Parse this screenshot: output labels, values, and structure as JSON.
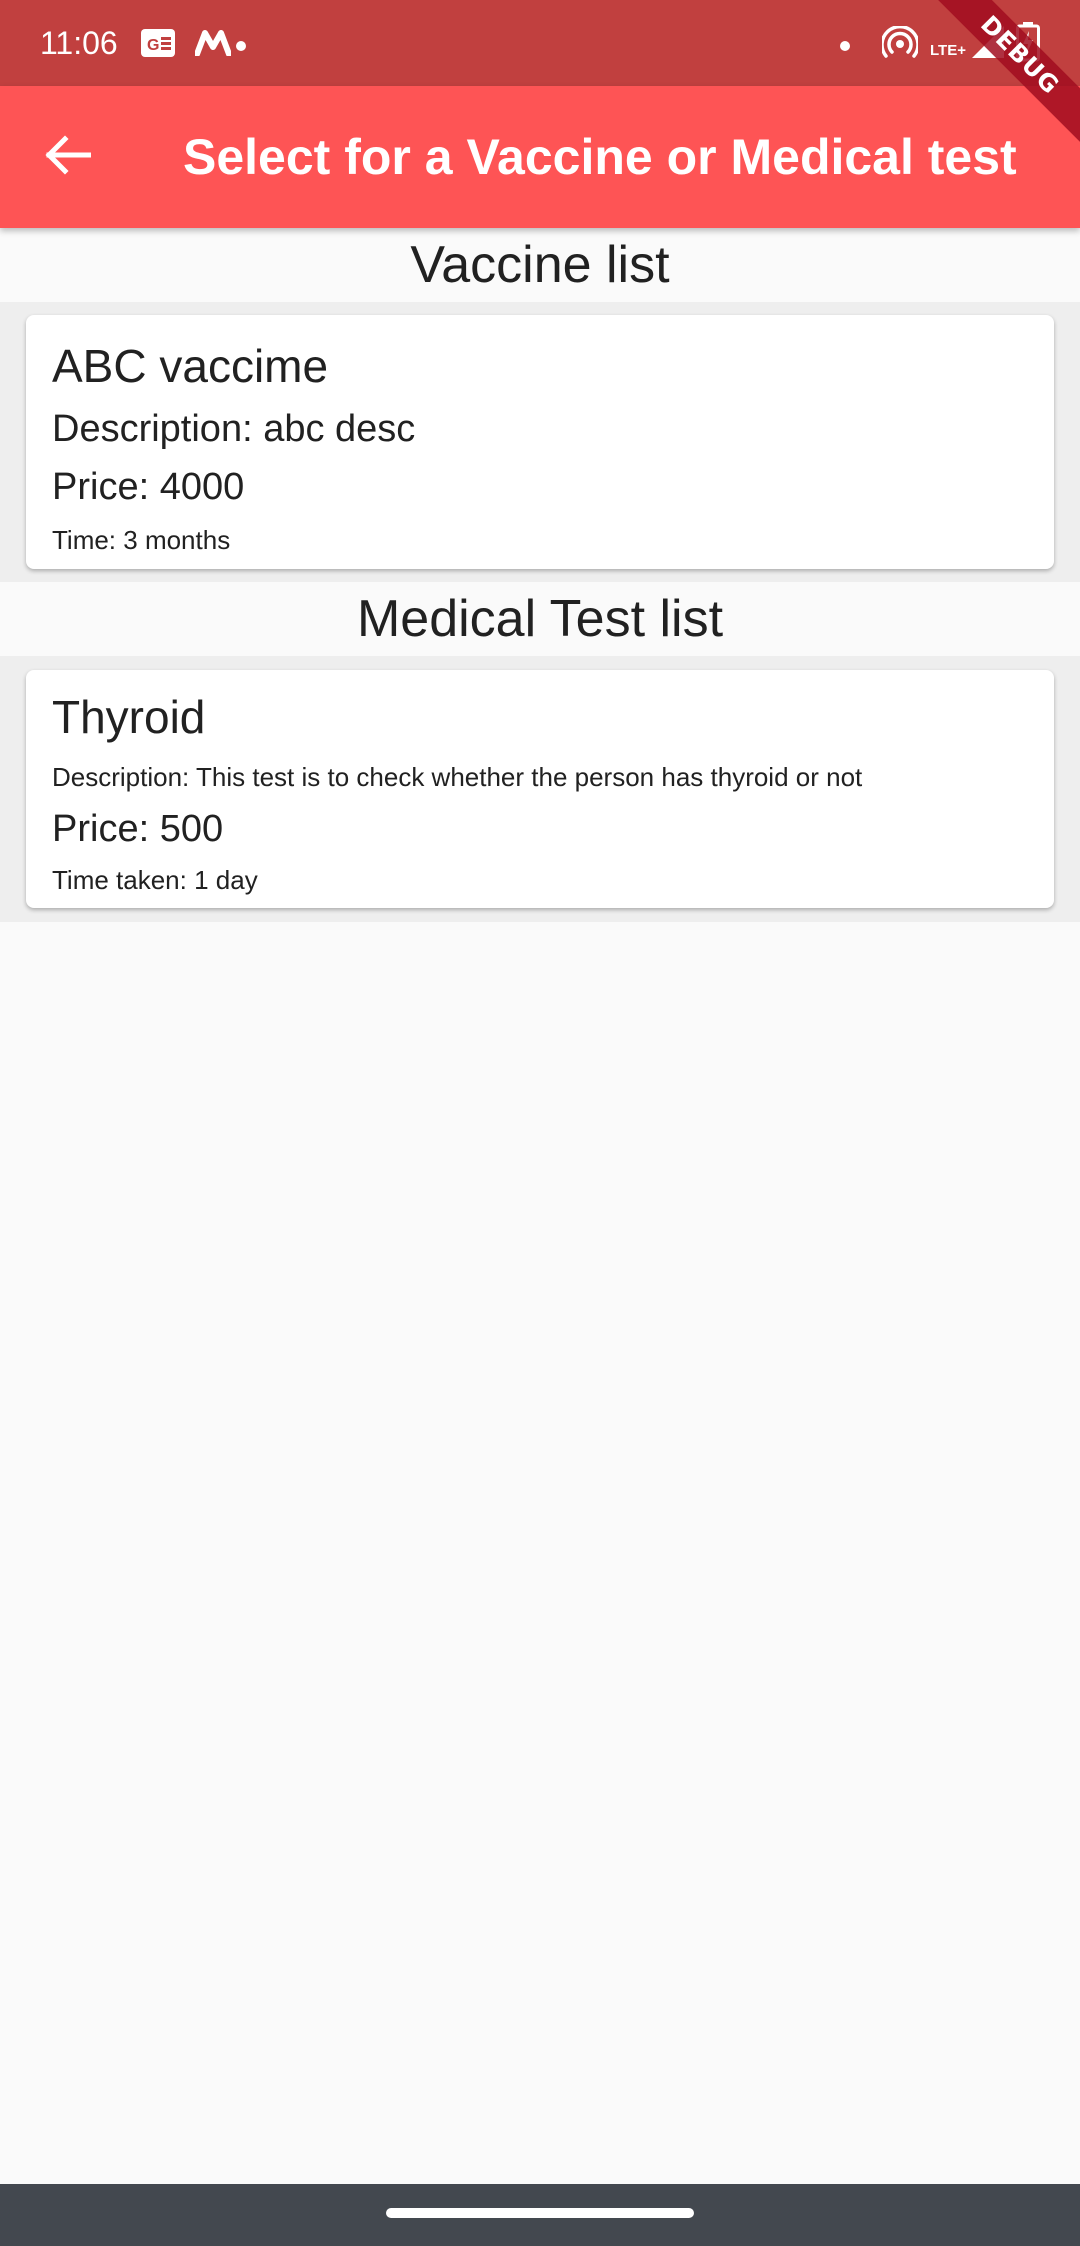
{
  "status_bar": {
    "time": "11:06",
    "network_label": "LTE+",
    "icons": [
      "news-icon",
      "m-app-icon",
      "dot-icon",
      "dot-icon",
      "hotspot-icon",
      "signal-icon",
      "battery-charging-icon"
    ]
  },
  "app_bar": {
    "title": "Select for a Vaccine or Medical test",
    "back_icon": "arrow-back-icon",
    "background": "#fe5455"
  },
  "debug_banner": {
    "label": "DEBUG"
  },
  "vaccine_section": {
    "header": "Vaccine list",
    "items": [
      {
        "name": "ABC vaccime",
        "description": "Description: abc desc",
        "price": "Price: 4000",
        "time": "Time: 3 months"
      }
    ]
  },
  "medical_section": {
    "header": "Medical Test list",
    "items": [
      {
        "name": "Thyroid",
        "description": "Description: This test is to check whether the person has thyroid or not",
        "price": "Price: 500",
        "time": "Time taken: 1 day"
      }
    ]
  },
  "colors": {
    "status_bar": "#c1403f",
    "app_bar": "#fe5455",
    "page_background": "#fafafa",
    "card_area": "#eeeeee",
    "nav_bar": "#43484f"
  }
}
